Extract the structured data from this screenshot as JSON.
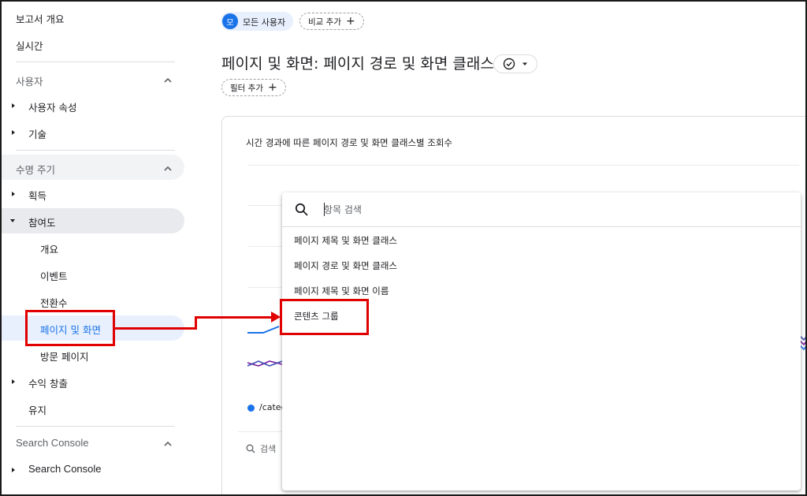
{
  "sidebar": {
    "top_items": [
      "보고서 개요",
      "실시간"
    ],
    "section_user": "사용자",
    "user_items": [
      "사용자 속성",
      "기술"
    ],
    "section_lifecycle": "수명 주기",
    "acquisition": "획득",
    "engagement": "참여도",
    "engagement_children": [
      "개요",
      "이벤트",
      "전환수",
      "페이지 및 화면",
      "방문 페이지"
    ],
    "monetization": "수익 창출",
    "retention": "유지",
    "section_search_console": "Search Console",
    "search_console_item": "Search Console"
  },
  "topbar": {
    "avatar_letter": "모",
    "all_users": "모든 사용자",
    "add_comparison": "비교 추가"
  },
  "title": "페이지 및 화면: 페이지 경로 및 화면 클래스",
  "add_filter": "필터 추가",
  "card": {
    "title": "시간 경과에 따른 페이지 경로 및 화면 클래스별 조회수",
    "legend_text": "/categ",
    "table_search": "검색"
  },
  "dropdown": {
    "search_placeholder": "항목 검색",
    "options": [
      "페이지 제목 및 화면 클래스",
      "페이지 경로 및 화면 클래스",
      "페이지 제목 및 화면 이름",
      "콘텐츠 그룹"
    ]
  },
  "colors": {
    "accent": "#1a73e8",
    "annotation": "#e00000",
    "selected_bg": "#e8f0fe",
    "hover_bg": "#e8eaed"
  }
}
